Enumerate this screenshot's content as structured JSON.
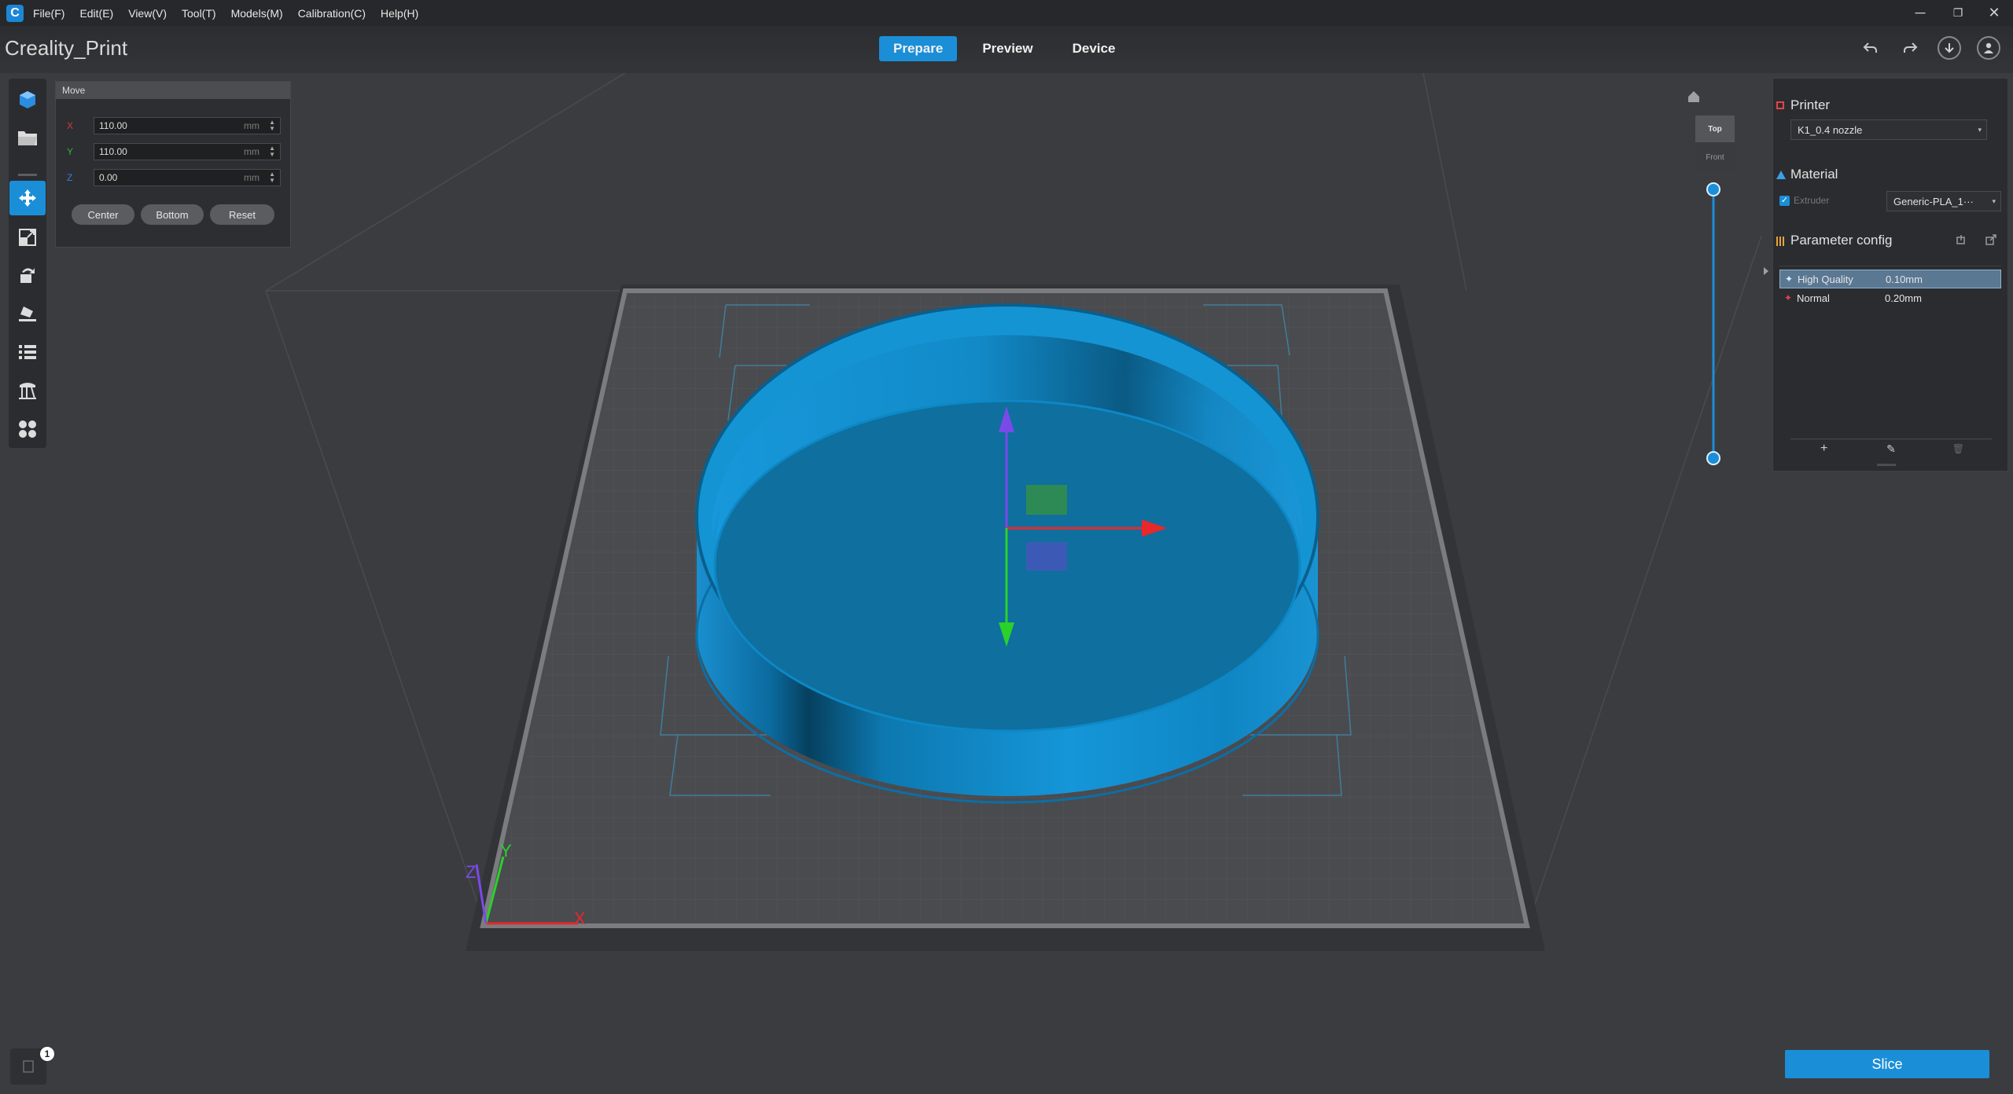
{
  "menu": {
    "items": [
      "File(F)",
      "Edit(E)",
      "View(V)",
      "Tool(T)",
      "Models(M)",
      "Calibration(C)",
      "Help(H)"
    ]
  },
  "window_controls": {
    "minimize": "─",
    "restore": "❐",
    "close": "✕"
  },
  "app": {
    "title": "Creality_Print",
    "logo": "C"
  },
  "tabs": [
    {
      "label": "Prepare",
      "active": true
    },
    {
      "label": "Preview",
      "active": false
    },
    {
      "label": "Device",
      "active": false
    }
  ],
  "move_panel": {
    "title": "Move",
    "x": {
      "label": "X",
      "value": "110.00",
      "unit": "mm",
      "color": "#d23a3a"
    },
    "y": {
      "label": "Y",
      "value": "110.00",
      "unit": "mm",
      "color": "#3ab03a"
    },
    "z": {
      "label": "Z",
      "value": "0.00",
      "unit": "mm",
      "color": "#3a7ad8"
    },
    "buttons": {
      "center": "Center",
      "bottom": "Bottom",
      "reset": "Reset"
    }
  },
  "toolbar": {
    "tools": [
      "add-model-icon",
      "open-file-icon",
      "move-icon",
      "scale-icon",
      "rotate-icon",
      "lay-flat-icon",
      "object-list-icon",
      "support-icon",
      "arrange-icon"
    ],
    "active_tool": "move-icon"
  },
  "view_slider": {
    "top_label": "Top",
    "front_label": "Front"
  },
  "right_panel": {
    "printer": {
      "title": "Printer",
      "selected": "K1_0.4 nozzle"
    },
    "material": {
      "title": "Material",
      "extruder_label": "Extruder",
      "extruder_checked": true,
      "selected": "Generic-PLA_1···"
    },
    "parameter_config": {
      "title": "Parameter config",
      "profiles": [
        {
          "name": "High Quality",
          "value": "0.10mm",
          "selected": true
        },
        {
          "name": "Normal",
          "value": "0.20mm",
          "selected": false
        }
      ],
      "actions": {
        "add": "+",
        "edit": "✎",
        "delete": "🗑"
      }
    }
  },
  "scene_axes": {
    "x": "X",
    "y": "Y",
    "z": "Z"
  },
  "colors": {
    "accent": "#1b8ed8",
    "model": "#0f8fcf",
    "x_axis": "#e8282b",
    "y_axis": "#2ad12a",
    "z_axis": "#7a4ae8"
  },
  "footer": {
    "slice_label": "Slice",
    "message_count": "1"
  }
}
